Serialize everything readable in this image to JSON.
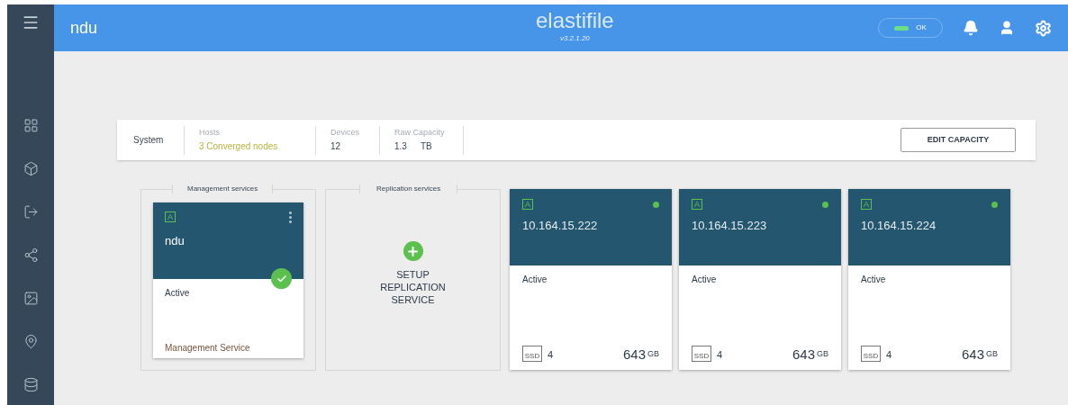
{
  "header": {
    "title": "ndu",
    "logo": "elastifile",
    "version": "v3.2.1.20",
    "status": {
      "label": "OK",
      "healthy": true
    }
  },
  "summary": {
    "label": "System",
    "stats": [
      {
        "label": "Hosts",
        "value": "3 Converged nodes",
        "kind": "highlight"
      },
      {
        "label": "Devices",
        "value": "12",
        "kind": "plain"
      },
      {
        "label": "Raw Capacity",
        "value": "1.3",
        "unit": "TB",
        "kind": "unit"
      }
    ],
    "button": "EDIT CAPACITY"
  },
  "management": {
    "title": "Management services",
    "card": {
      "badge": "A",
      "name": "ndu",
      "status": "Active",
      "ok": true,
      "footer": "Management Service"
    }
  },
  "replication": {
    "title": "Replication services",
    "action": "SETUP REPLICATION SERVICE"
  },
  "nodes": [
    {
      "badge": "A",
      "ip": "10.164.15.222",
      "status": "Active",
      "color": "#5cc04e",
      "drive": "SSD",
      "drives": "4",
      "capacity": "643",
      "unit": "GB"
    },
    {
      "badge": "A",
      "ip": "10.164.15.223",
      "status": "Active",
      "color": "#5cc04e",
      "drive": "SSD",
      "drives": "4",
      "capacity": "643",
      "unit": "GB"
    },
    {
      "badge": "A",
      "ip": "10.164.15.224",
      "status": "Active",
      "color": "#5cc04e",
      "drive": "SSD",
      "drives": "4",
      "capacity": "643",
      "unit": "GB"
    }
  ]
}
